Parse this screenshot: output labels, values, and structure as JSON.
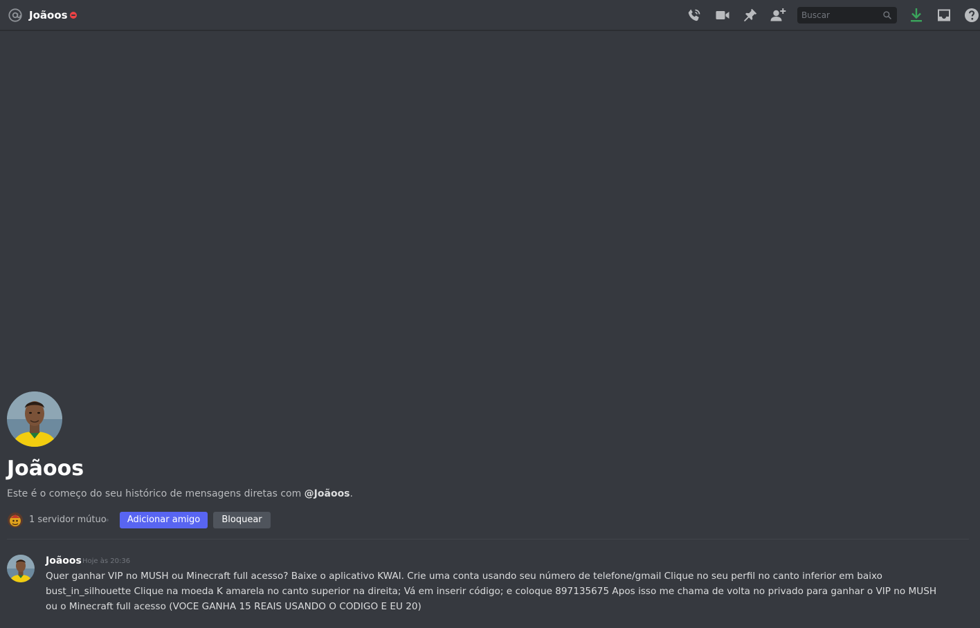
{
  "header": {
    "channel_name": "Joãoos",
    "status": "dnd",
    "icons": [
      "at-icon",
      "start-voice-call-icon",
      "start-video-call-icon",
      "pinned-messages-icon",
      "add-friends-to-dm-icon",
      "download-icon",
      "inbox-icon",
      "help-icon"
    ],
    "search": {
      "placeholder": "Buscar",
      "value": ""
    }
  },
  "colors": {
    "background": "#36393f",
    "primary_button": "#5865f2",
    "secondary_button": "#4f545c",
    "dnd_status": "#ed4245",
    "download_icon": "#3ba55c",
    "avatar_shirt": "#f2cd0f"
  },
  "dm_start": {
    "title": "Joãoos",
    "description_prefix": "Este é o começo do seu histórico de mensagens diretas com ",
    "description_user": "@Joãoos",
    "description_suffix": ".",
    "mutual_servers": "1 servidor mútuo",
    "add_friend_label": "Adicionar amigo",
    "block_label": "Bloquear"
  },
  "messages": [
    {
      "author": "Joãoos",
      "timestamp": "Hoje às 20:36",
      "content": "Quer ganhar VIP no MUSH ou Minecraft full acesso? Baixe o aplicativo KWAI.  Crie uma conta usando seu número de telefone/gmail  Clique no seu perfil no canto inferior em baixo bust_in_silhouette Clique na moeda K amarela no canto superior na direita; Vá em inserir código; e coloque  897135675  Apos isso me chama de volta no privado para ganhar o VIP no MUSH ou o Minecraft full acesso (VOCE GANHA 15 REAIS USANDO O CODIGO E EU 20)"
    }
  ]
}
